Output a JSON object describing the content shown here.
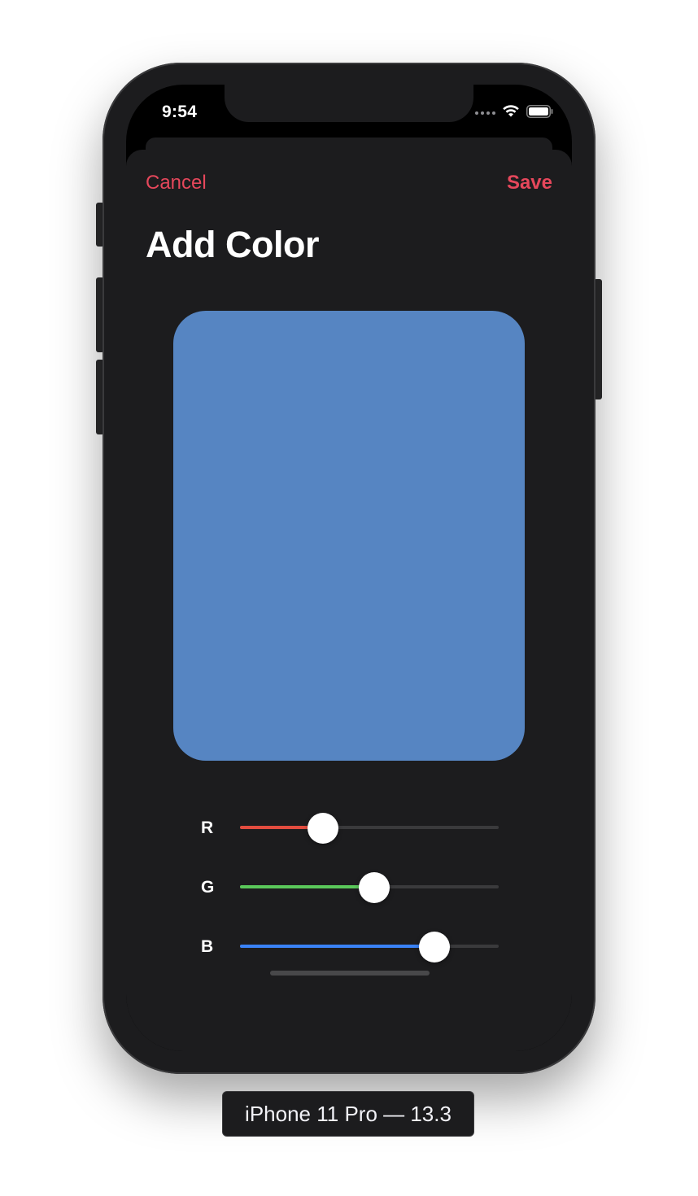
{
  "status_bar": {
    "time": "9:54",
    "icons": [
      "cellular-dots-icon",
      "wifi-icon",
      "battery-icon"
    ]
  },
  "nav": {
    "cancel_label": "Cancel",
    "save_label": "Save"
  },
  "title": "Add Color",
  "swatch": {
    "color": "#5685c2"
  },
  "sliders": [
    {
      "label": "R",
      "value": 0.32,
      "color": "#e24c3f"
    },
    {
      "label": "G",
      "value": 0.52,
      "color": "#5ac85a"
    },
    {
      "label": "B",
      "value": 0.75,
      "color": "#3a82f6"
    }
  ],
  "device_label": "iPhone 11 Pro — 13.3",
  "colors": {
    "accent": "#e5475b",
    "sheet_background": "#1c1c1e",
    "track_unfilled": "#3a3a3c"
  }
}
